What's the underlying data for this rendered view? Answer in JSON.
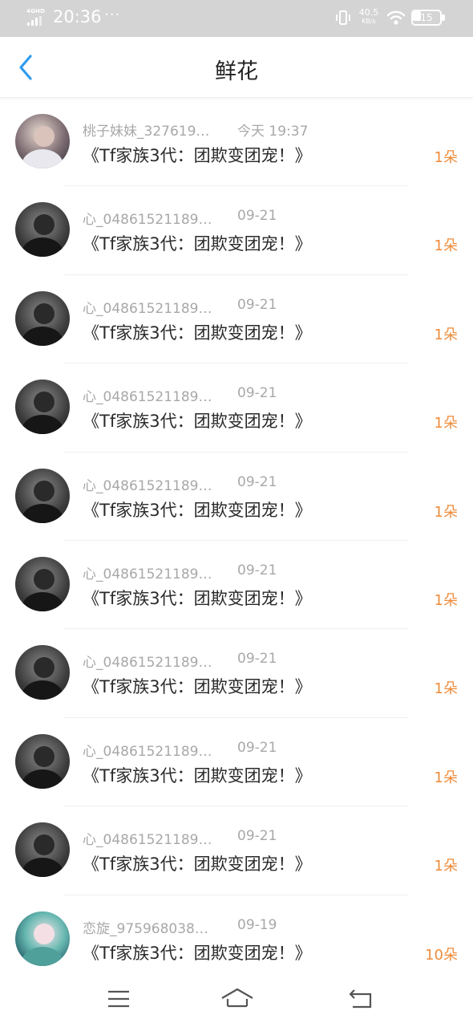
{
  "status_bar": {
    "network": "4GHD",
    "time": "20:36",
    "dots": "···",
    "speed_value": "40.5",
    "speed_unit": "KB/s",
    "battery": "15"
  },
  "header": {
    "title": "鲜花",
    "back_icon": "chevron-left-icon"
  },
  "colors": {
    "accent": "#2f9cf0",
    "count": "#ef8c3b",
    "meta": "#a8a8a8",
    "title": "#2a2a2a"
  },
  "items": [
    {
      "user": "桃子妹妹_327619…",
      "time": "今天 19:37",
      "title": "《Tf家族3代：团欺变团宠！》",
      "count": "1朵",
      "avatar": "first"
    },
    {
      "user": "心_04861521189…",
      "time": "09-21",
      "title": "《Tf家族3代：团欺变团宠！》",
      "count": "1朵",
      "avatar": "guy"
    },
    {
      "user": "心_04861521189…",
      "time": "09-21",
      "title": "《Tf家族3代：团欺变团宠！》",
      "count": "1朵",
      "avatar": "guy"
    },
    {
      "user": "心_04861521189…",
      "time": "09-21",
      "title": "《Tf家族3代：团欺变团宠！》",
      "count": "1朵",
      "avatar": "guy"
    },
    {
      "user": "心_04861521189…",
      "time": "09-21",
      "title": "《Tf家族3代：团欺变团宠！》",
      "count": "1朵",
      "avatar": "guy"
    },
    {
      "user": "心_04861521189…",
      "time": "09-21",
      "title": "《Tf家族3代：团欺变团宠！》",
      "count": "1朵",
      "avatar": "guy"
    },
    {
      "user": "心_04861521189…",
      "time": "09-21",
      "title": "《Tf家族3代：团欺变团宠！》",
      "count": "1朵",
      "avatar": "guy"
    },
    {
      "user": "心_04861521189…",
      "time": "09-21",
      "title": "《Tf家族3代：团欺变团宠！》",
      "count": "1朵",
      "avatar": "guy"
    },
    {
      "user": "心_04861521189…",
      "time": "09-21",
      "title": "《Tf家族3代：团欺变团宠！》",
      "count": "1朵",
      "avatar": "guy"
    },
    {
      "user": "恋旋_975968038…",
      "time": "09-19",
      "title": "《Tf家族3代：团欺变团宠！》",
      "count": "10朵",
      "avatar": "anime"
    }
  ],
  "nav": {
    "menu_icon": "menu-icon",
    "home_icon": "home-icon",
    "back_icon": "back-icon"
  }
}
